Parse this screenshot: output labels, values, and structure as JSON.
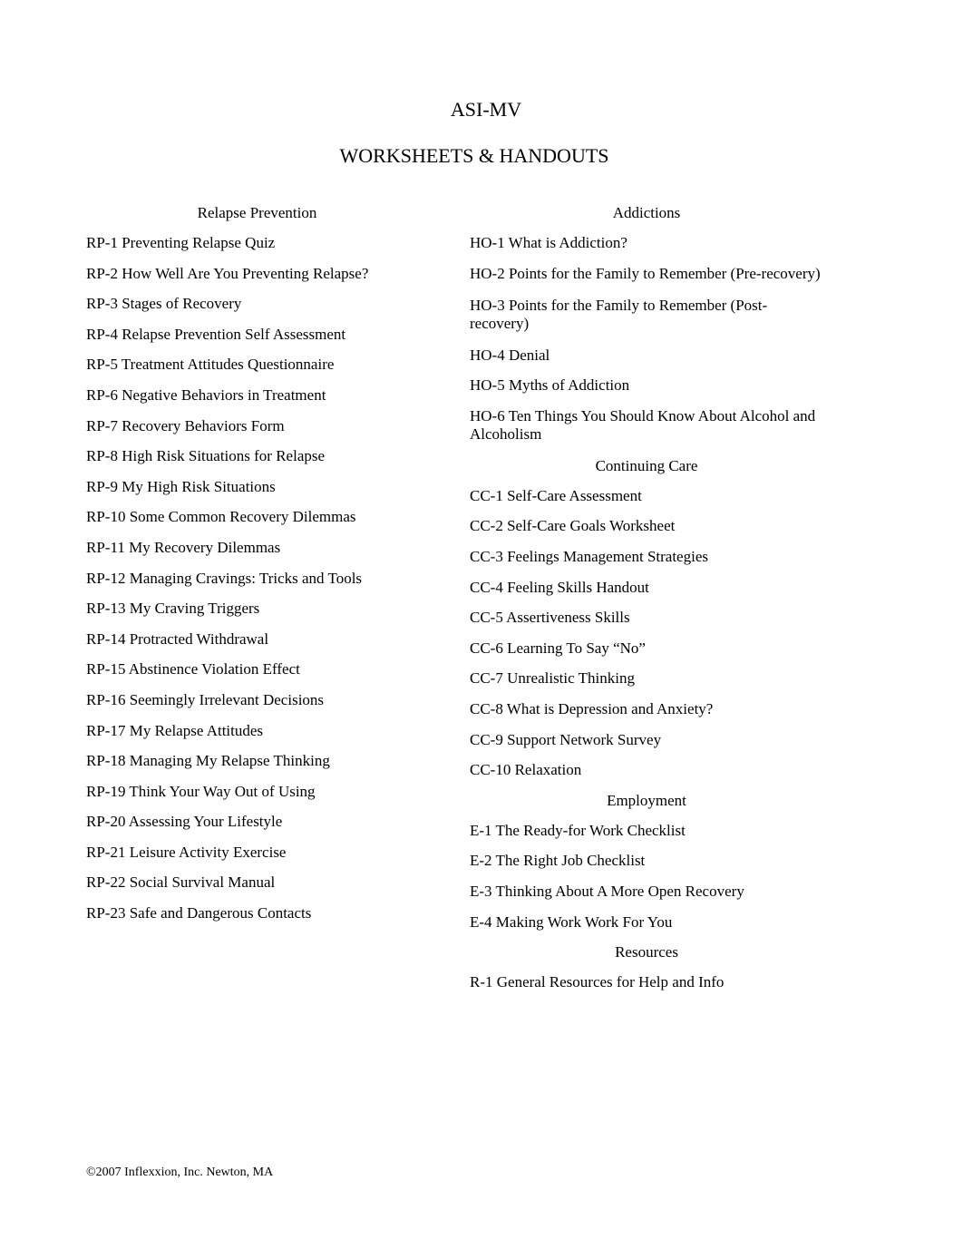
{
  "header": {
    "title": "ASI-MV",
    "subtitle": "WORKSHEETS & HANDOUTS"
  },
  "left_column": {
    "sections": [
      {
        "heading": "Relapse Prevention",
        "items": [
          "RP-1 Preventing Relapse Quiz",
          "RP-2 How Well Are You Preventing Relapse?",
          "RP-3 Stages of Recovery",
          "RP-4 Relapse Prevention Self Assessment",
          "RP-5 Treatment Attitudes Questionnaire",
          "RP-6 Negative Behaviors in Treatment",
          "RP-7 Recovery Behaviors Form",
          "RP-8 High Risk Situations for Relapse",
          "RP-9 My High Risk Situations",
          "RP-10 Some Common Recovery Dilemmas",
          "RP-11 My Recovery Dilemmas",
          "RP-12 Managing Cravings: Tricks and Tools",
          "RP-13 My Craving Triggers",
          "RP-14 Protracted Withdrawal",
          "RP-15 Abstinence Violation Effect",
          "RP-16 Seemingly Irrelevant Decisions",
          "RP-17 My Relapse Attitudes",
          "RP-18 Managing My Relapse Thinking",
          "RP-19 Think Your Way Out of Using",
          "RP-20 Assessing Your Lifestyle",
          "RP-21 Leisure Activity Exercise",
          "RP-22 Social Survival Manual",
          "RP-23 Safe and Dangerous Contacts"
        ]
      }
    ]
  },
  "right_column": {
    "sections": [
      {
        "heading": "Addictions",
        "items": [
          "HO-1 What is Addiction?",
          "HO-2 Points for the Family to Remember (Pre-recovery)",
          "HO-3 Points for the Family to Remember (Post-recovery)",
          "HO-4 Denial",
          "HO-5 Myths of Addiction",
          "HO-6 Ten Things You Should Know About Alcohol and Alcoholism"
        ]
      },
      {
        "heading": "Continuing Care",
        "items": [
          "CC-1 Self-Care Assessment",
          "CC-2 Self-Care Goals Worksheet",
          "CC-3 Feelings Management Strategies",
          "CC-4 Feeling Skills Handout",
          "CC-5 Assertiveness Skills",
          "CC-6 Learning To Say “No”",
          "CC-7 Unrealistic Thinking",
          "CC-8 What is Depression and Anxiety?",
          "CC-9 Support Network Survey",
          "CC-10 Relaxation"
        ]
      },
      {
        "heading": "Employment",
        "items": [
          "E-1 The Ready-for Work Checklist",
          "E-2 The Right Job Checklist",
          "E-3 Thinking About A More Open Recovery",
          "E-4 Making Work Work For You"
        ]
      },
      {
        "heading": "Resources",
        "items": [
          "R-1 General Resources for Help and Info"
        ]
      }
    ]
  },
  "footer": {
    "copyright": "©2007 Inflexxion, Inc. Newton, MA"
  }
}
